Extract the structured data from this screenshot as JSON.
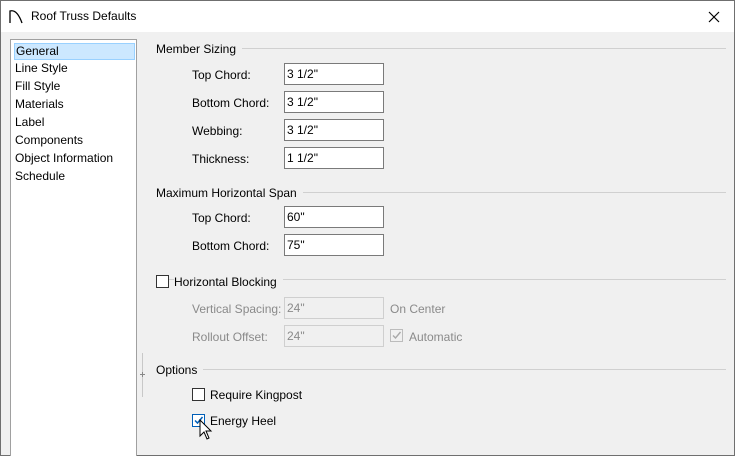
{
  "window": {
    "title": "Roof Truss Defaults",
    "icon": "roof-curve-icon",
    "close_icon": "close-icon"
  },
  "sidebar": {
    "items": [
      {
        "label": "General",
        "selected": true
      },
      {
        "label": "Line Style",
        "selected": false
      },
      {
        "label": "Fill Style",
        "selected": false
      },
      {
        "label": "Materials",
        "selected": false
      },
      {
        "label": "Label",
        "selected": false
      },
      {
        "label": "Components",
        "selected": false
      },
      {
        "label": "Object Information",
        "selected": false
      },
      {
        "label": "Schedule",
        "selected": false
      }
    ]
  },
  "member_sizing": {
    "title": "Member Sizing",
    "top_chord_label": "Top Chord:",
    "top_chord_value": "3 1/2\"",
    "bottom_chord_label": "Bottom Chord:",
    "bottom_chord_value": "3 1/2\"",
    "webbing_label": "Webbing:",
    "webbing_value": "3 1/2\"",
    "thickness_label": "Thickness:",
    "thickness_value": "1 1/2\""
  },
  "max_span": {
    "title": "Maximum Horizontal Span",
    "top_chord_label": "Top Chord:",
    "top_chord_value": "60\"",
    "bottom_chord_label": "Bottom Chord:",
    "bottom_chord_value": "75\""
  },
  "blocking": {
    "title": "Horizontal Blocking",
    "checked": false,
    "vertical_spacing_label": "Vertical Spacing:",
    "vertical_spacing_value": "24\"",
    "on_center_label": "On Center",
    "rollout_offset_label": "Rollout Offset:",
    "rollout_offset_value": "24\"",
    "automatic_label": "Automatic",
    "automatic_checked": true
  },
  "options": {
    "title": "Options",
    "require_kingpost_label": "Require Kingpost",
    "require_kingpost_checked": false,
    "energy_heel_label": "Energy Heel",
    "energy_heel_checked": true
  },
  "colors": {
    "selection_bg": "#cce8ff",
    "selection_border": "#99d1ff",
    "check_blue": "#005fb8"
  }
}
